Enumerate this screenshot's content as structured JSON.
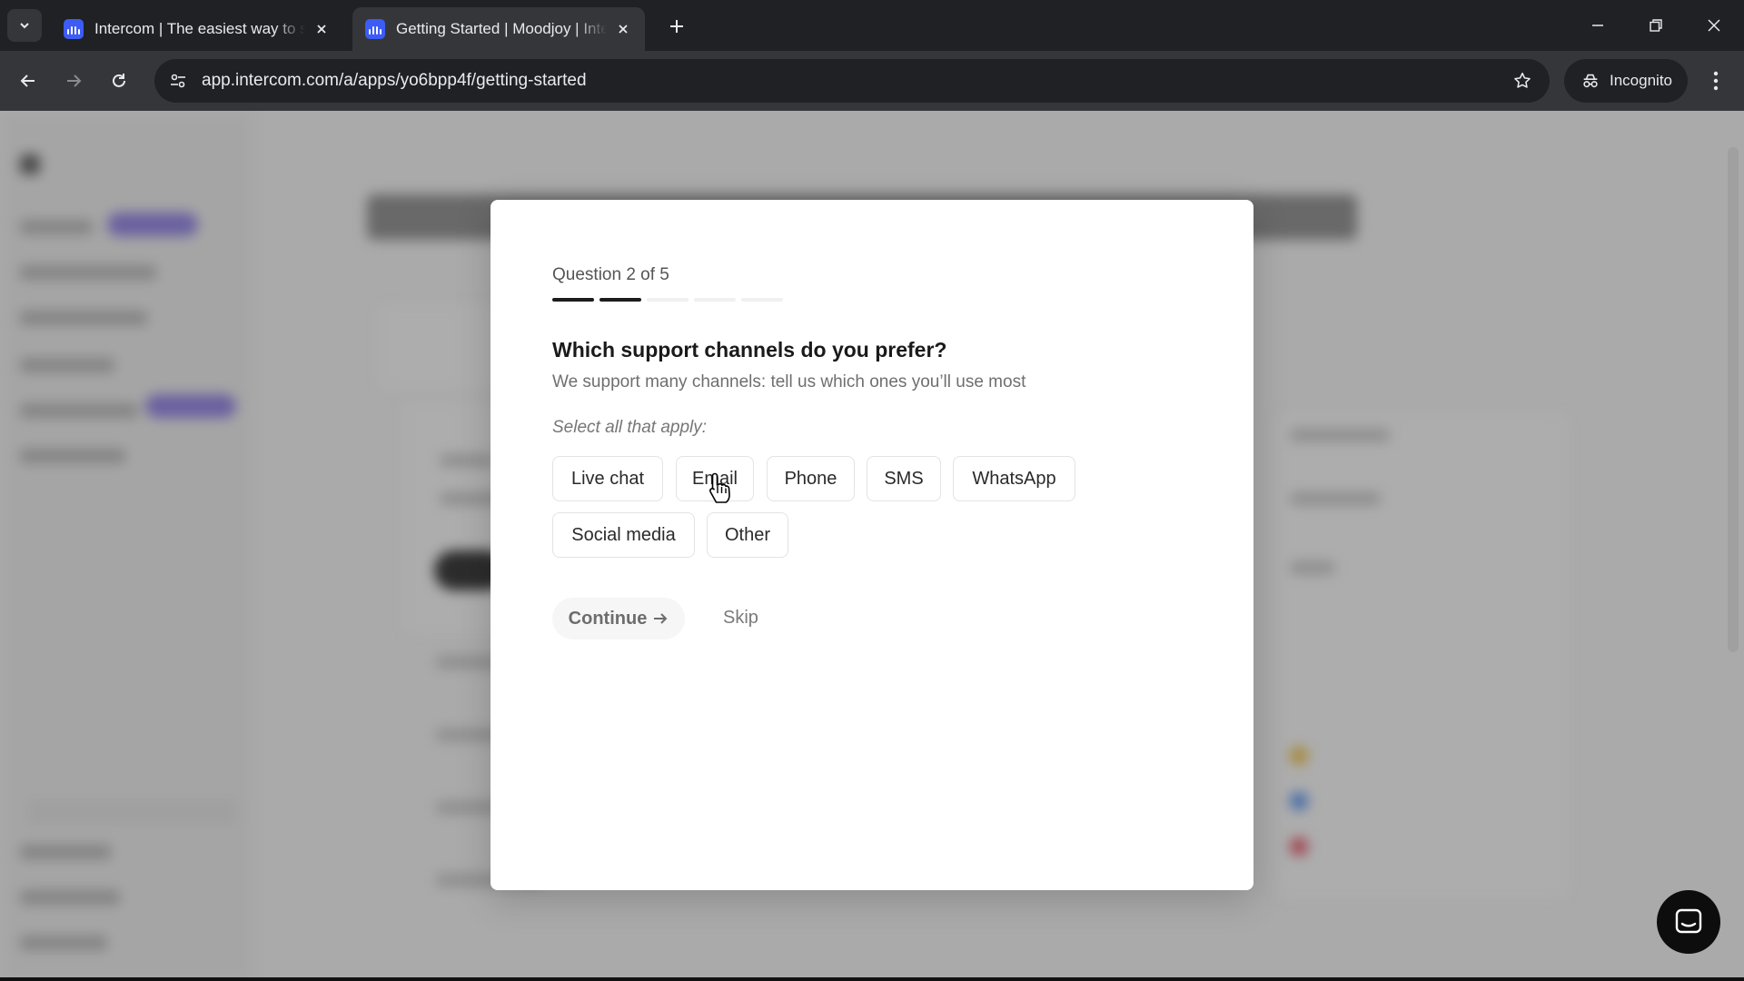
{
  "browser": {
    "tabs": [
      {
        "title": "Intercom | The easiest way to se",
        "active": false
      },
      {
        "title": "Getting Started | Moodjoy | Inte",
        "active": true
      }
    ],
    "url": "app.intercom.com/a/apps/yo6bpp4f/getting-started",
    "incognito_label": "Incognito",
    "accent_color": "#3d5cf5"
  },
  "modal": {
    "question_counter": "Question 2 of 5",
    "progress": {
      "current": 2,
      "total": 5
    },
    "title": "Which support channels do you prefer?",
    "subtitle": "We support many channels: tell us which ones you’ll use most",
    "hint": "Select all that apply:",
    "options": [
      {
        "label": "Live chat"
      },
      {
        "label": "Email"
      },
      {
        "label": "Phone"
      },
      {
        "label": "SMS"
      },
      {
        "label": "WhatsApp"
      },
      {
        "label": "Social media"
      },
      {
        "label": "Other"
      }
    ],
    "continue_label": "Continue",
    "continue_icon": "arrow-right-icon",
    "skip_label": "Skip"
  },
  "launcher": {
    "icon": "messenger-icon"
  }
}
